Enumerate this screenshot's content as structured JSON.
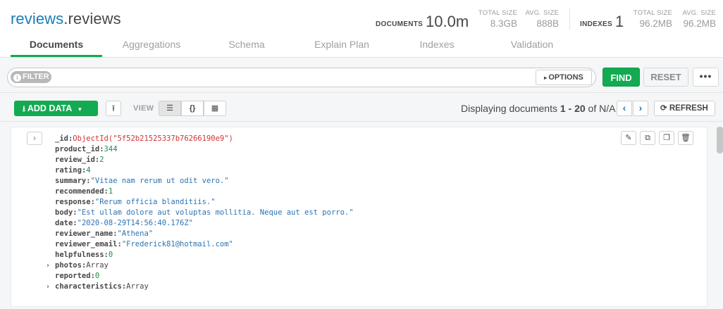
{
  "header": {
    "db": "reviews",
    "collection": ".reviews",
    "documents_label": "DOCUMENTS",
    "documents_value": "10.0m",
    "total_size_label": "TOTAL SIZE",
    "total_size_value": "8.3GB",
    "avg_size_label": "AVG. SIZE",
    "avg_size_value": "888B",
    "indexes_label": "INDEXES",
    "indexes_value": "1",
    "idx_total_size_label": "TOTAL SIZE",
    "idx_total_size_value": "96.2MB",
    "idx_avg_size_label": "AVG. SIZE",
    "idx_avg_size_value": "96.2MB"
  },
  "tabs": [
    {
      "label": "Documents",
      "active": true
    },
    {
      "label": "Aggregations"
    },
    {
      "label": "Schema"
    },
    {
      "label": "Explain Plan"
    },
    {
      "label": "Indexes"
    },
    {
      "label": "Validation"
    }
  ],
  "query": {
    "filter_label": "FILTER",
    "options_label": "OPTIONS",
    "find_label": "FIND",
    "reset_label": "RESET",
    "more_label": "•••"
  },
  "toolbar": {
    "add_data_label": "ADD DATA",
    "view_label": "VIEW",
    "pager_prefix": "Displaying documents ",
    "pager_range": "1 - 20",
    "pager_suffix": " of N/A",
    "refresh_label": "REFRESH"
  },
  "document": {
    "fields": [
      {
        "key": "_id",
        "value": "ObjectId(\"5f52b21525337b76266190e9\")",
        "type": "oid"
      },
      {
        "key": "product_id",
        "value": "344",
        "type": "num"
      },
      {
        "key": "review_id",
        "value": "2",
        "type": "num"
      },
      {
        "key": "rating",
        "value": "4",
        "type": "num"
      },
      {
        "key": "summary",
        "value": "\"Vitae nam rerum ut odit vero.\"",
        "type": "str"
      },
      {
        "key": "recommended",
        "value": "1",
        "type": "num"
      },
      {
        "key": "response",
        "value": "\"Rerum officia blanditiis.\"",
        "type": "str"
      },
      {
        "key": "body",
        "value": "\"Est ullam dolore aut voluptas mollitia. Neque aut est porro.\"",
        "type": "str"
      },
      {
        "key": "date",
        "value": "\"2020-08-29T14:56:40.176Z\"",
        "type": "str"
      },
      {
        "key": "reviewer_name",
        "value": "\"Athena\"",
        "type": "str"
      },
      {
        "key": "reviewer_email",
        "value": "\"Frederick81@hotmail.com\"",
        "type": "str"
      },
      {
        "key": "helpfulness",
        "value": "0",
        "type": "num"
      },
      {
        "key": "photos",
        "value": "Array",
        "type": "arr",
        "expandable": true
      },
      {
        "key": "reported",
        "value": "0",
        "type": "num"
      },
      {
        "key": "characteristics",
        "value": "Array",
        "type": "arr",
        "expandable": true
      }
    ]
  },
  "colors": {
    "accent_green": "#13aa52",
    "link_blue": "#1a7cb8",
    "string_blue": "#2b73b6",
    "number_green": "#168f4b",
    "objectid_red": "#d33232"
  }
}
